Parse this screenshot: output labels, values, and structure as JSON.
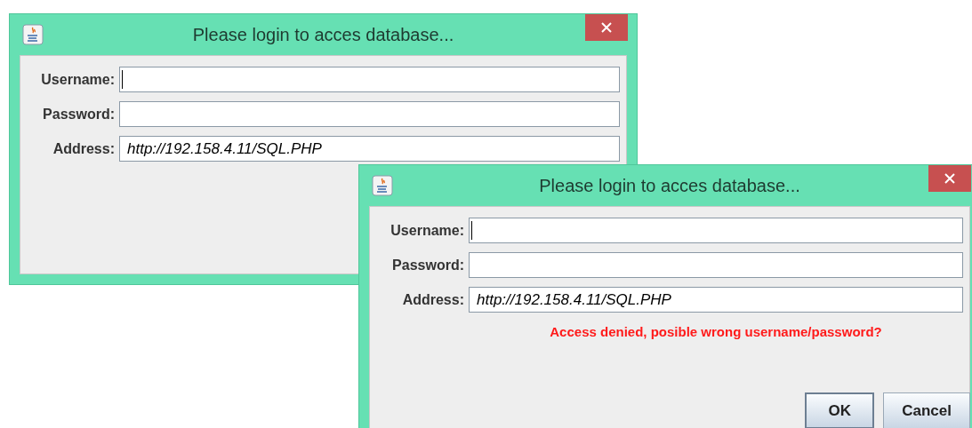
{
  "windows": [
    {
      "title": "Please login to acces database...",
      "fields": [
        {
          "label": "Username:",
          "focused": true
        },
        {
          "label": "Password:",
          "focused": false
        },
        {
          "label": "Address:",
          "value": "http://192.158.4.11/SQL.PHP",
          "focused": false
        }
      ]
    },
    {
      "title": "Please login to acces database...",
      "fields": [
        {
          "label": "Username:",
          "focused": true
        },
        {
          "label": "Password:",
          "focused": false
        },
        {
          "label": "Address:",
          "value": "http://192.158.4.11/SQL.PHP",
          "focused": false
        }
      ],
      "error": "Access denied, posible wrong username/password?",
      "buttons": [
        {
          "label": "OK",
          "default": true
        },
        {
          "label": "Cancel",
          "default": false
        }
      ]
    }
  ]
}
